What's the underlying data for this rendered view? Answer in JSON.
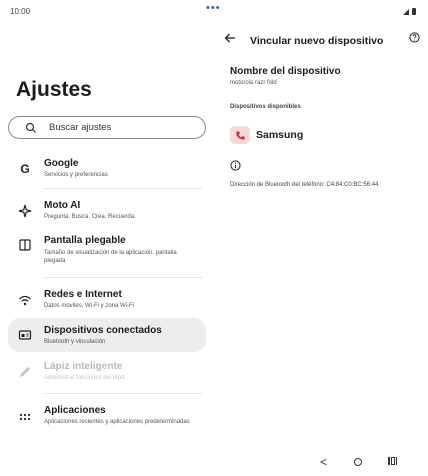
{
  "status_bar": {
    "time": "10:00",
    "center_dots": "•••"
  },
  "settings": {
    "title": "Ajustes",
    "search_placeholder": "Buscar ajustes",
    "items": [
      {
        "title": "Google",
        "subtitle": "Servicios y preferencias",
        "icon": "google-icon"
      },
      {
        "title": "Moto AI",
        "subtitle": "Pregunta. Busca. Crea. Recuerda.",
        "icon": "moto-ai-icon"
      },
      {
        "title": "Pantalla plegable",
        "subtitle": "Tamaño de visualización de la aplicación, pantalla plegada",
        "icon": "foldable-screen-icon"
      },
      {
        "title": "Redes e Internet",
        "subtitle": "Datos móviles, Wi-Fi y zona Wi-Fi",
        "icon": "wifi-icon"
      },
      {
        "title": "Dispositivos conectados",
        "subtitle": "Bluetooth y vinculación",
        "icon": "connected-devices-icon",
        "selected": true
      },
      {
        "title": "Lápiz inteligente",
        "subtitle": "Administrar funciones del lápiz",
        "icon": "stylus-icon",
        "disabled": true
      },
      {
        "title": "Aplicaciones",
        "subtitle": "Aplicaciones recientes y aplicaciones predeterminadas",
        "icon": "apps-grid-icon"
      }
    ]
  },
  "pairing": {
    "title": "Vincular nuevo dispositivo",
    "device_name_label": "Nombre del dispositivo",
    "device_name_value": "motorola razr fold",
    "available_label": "Dispositivos disponibles",
    "devices": [
      {
        "name": "Samsung",
        "icon": "phone-icon"
      }
    ],
    "bt_address": "Dirección de Bluetooth del teléfono: C4:84:C0:BC:56:44"
  },
  "nav_bar": {
    "back": "<"
  },
  "colors": {
    "accent": "#3a55c8",
    "selected_bg": "#ededed",
    "device_icon_bg": "#f8d7d9",
    "device_icon_fg": "#c2333d"
  }
}
